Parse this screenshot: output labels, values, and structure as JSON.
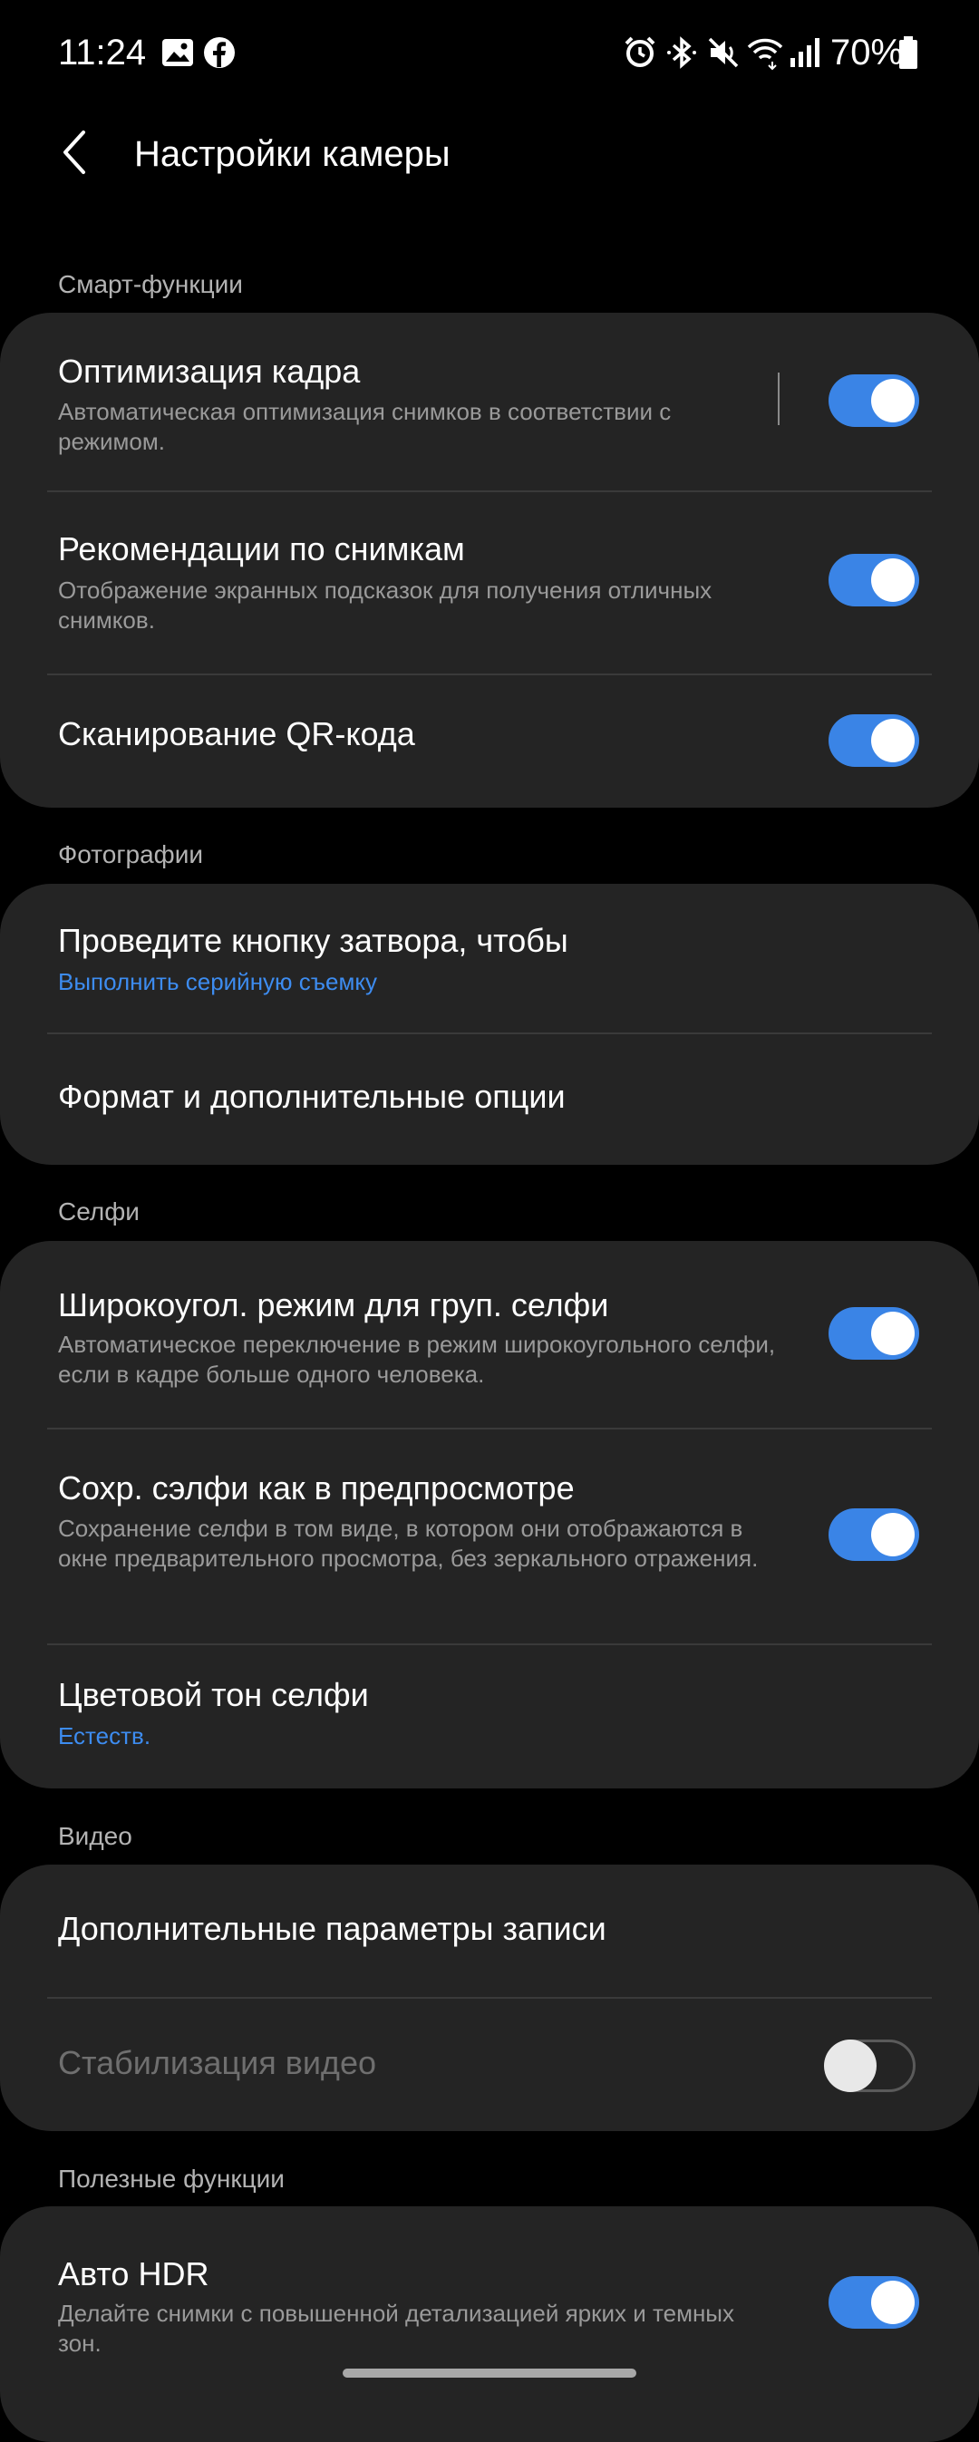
{
  "status_bar": {
    "time": "11:24",
    "battery": "70%"
  },
  "header": {
    "title": "Настройки камеры"
  },
  "sections": {
    "smart": {
      "label": "Смарт-функции",
      "items": [
        {
          "title": "Оптимизация кадра",
          "subtitle": "Автоматическая оптимизация снимков в соответствии с режимом.",
          "toggle": "on"
        },
        {
          "title": "Рекомендации по снимкам",
          "subtitle": "Отображение экранных подсказок для получения отличных снимков.",
          "toggle": "on"
        },
        {
          "title": "Сканирование QR-кода",
          "toggle": "on"
        }
      ]
    },
    "photos": {
      "label": "Фотографии",
      "items": [
        {
          "title": "Проведите кнопку затвора, чтобы",
          "value": "Выполнить серийную съемку"
        },
        {
          "title": "Формат и дополнительные опции"
        }
      ]
    },
    "selfie": {
      "label": "Селфи",
      "items": [
        {
          "title": "Широкоугол. режим для груп. селфи",
          "subtitle": "Автоматическое переключение в режим широкоугольного селфи, если в кадре больше одного человека.",
          "toggle": "on"
        },
        {
          "title": "Сохр. сэлфи как в предпросмотре",
          "subtitle": "Сохранение селфи в том виде, в котором они отображаются в окне предварительного просмотра, без зеркального отражения.",
          "toggle": "on"
        },
        {
          "title": "Цветовой тон селфи",
          "value": "Естеств."
        }
      ]
    },
    "video": {
      "label": "Видео",
      "items": [
        {
          "title": "Дополнительные параметры записи"
        },
        {
          "title": "Стабилизация видео",
          "toggle": "off",
          "disabled": true
        }
      ]
    },
    "useful": {
      "label": "Полезные функции",
      "items": [
        {
          "title": "Авто HDR",
          "subtitle": "Делайте снимки с повышенной детализацией ярких и темных зон.",
          "toggle": "on"
        }
      ]
    }
  },
  "colors": {
    "accent": "#3a84e6",
    "card": "#242424",
    "background": "#000000"
  }
}
